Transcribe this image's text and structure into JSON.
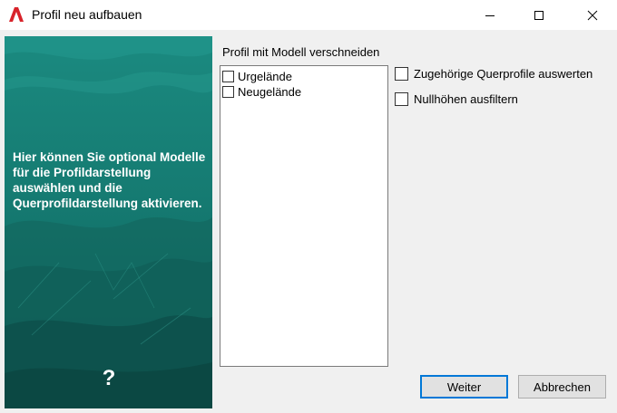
{
  "window": {
    "title": "Profil neu aufbauen",
    "icon": "autocad-logo-icon"
  },
  "side_panel": {
    "text": "Hier können Sie optional Modelle für die Profildarstellung auswählen und die Querprofildarstellung aktivieren.",
    "help_glyph": "?",
    "colors": {
      "teal": "#1a7d74",
      "dark_teal": "#0f5a55"
    }
  },
  "models_group": {
    "label": "Profil mit Modell verschneiden",
    "items": [
      {
        "label": "Urgelände",
        "checked": false
      },
      {
        "label": "Neugelände",
        "checked": false
      }
    ]
  },
  "options": {
    "cross_sections": {
      "label": "Zugehörige Querprofile auswerten",
      "checked": false
    },
    "filter_zero": {
      "label": "Nullhöhen ausfiltern",
      "checked": false
    }
  },
  "buttons": {
    "next": "Weiter",
    "cancel": "Abbrechen"
  },
  "colors": {
    "accent": "#0078d7",
    "dialog_bg": "#f0f0f0"
  }
}
